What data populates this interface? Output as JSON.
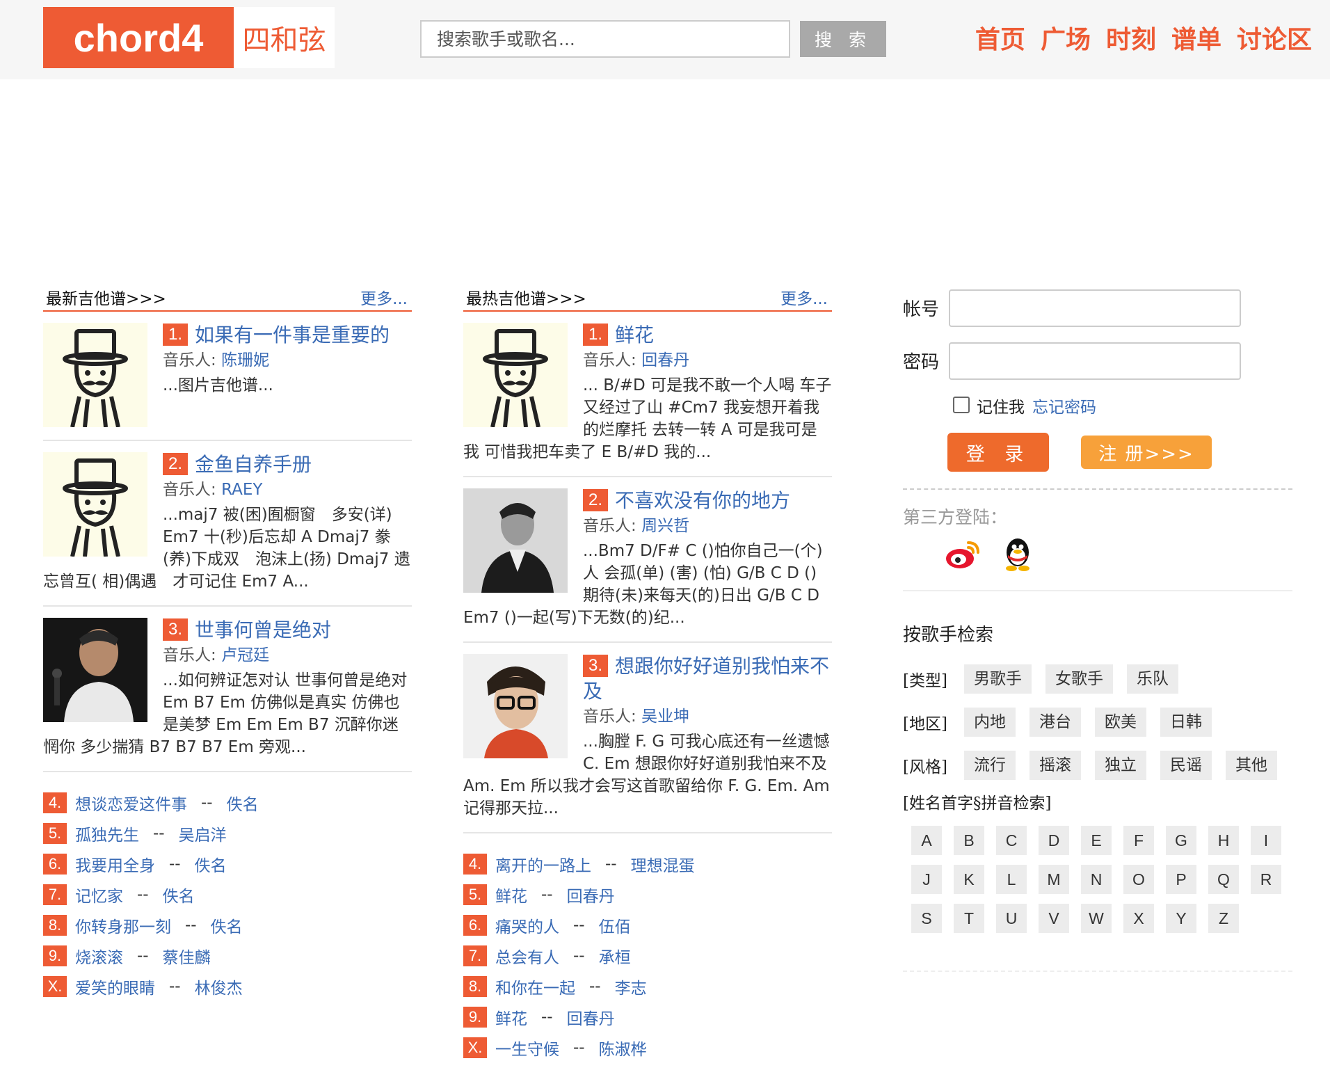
{
  "header": {
    "logo_main": "chord4",
    "logo_cn": "四和弦",
    "search_placeholder": "搜索歌手或歌名...",
    "search_button": "搜 索",
    "nav": [
      "首页",
      "广场",
      "时刻",
      "谱单",
      "讨论区"
    ]
  },
  "latest": {
    "title": "最新吉他谱>>>",
    "more": "更多...",
    "featured": [
      {
        "num": "1.",
        "title": "如果有一件事是重要的",
        "artist_label": "音乐人:",
        "artist": "陈珊妮",
        "snippet": "...图片吉他谱...",
        "thumb": "hat-man"
      },
      {
        "num": "2.",
        "title": "金鱼自养手册",
        "artist_label": "音乐人:",
        "artist": "RAEY",
        "snippet": "...maj7 被(困)囿橱窗　多安(详) Em7 十(秒)后忘却 A Dmaj7 豢(养)下成双　泡沫上(扬) Dmaj7 遗忘曾互( 相)偶遇　才可记住 Em7 A...",
        "thumb": "hat-man"
      },
      {
        "num": "3.",
        "title": "世事何曾是绝对",
        "artist_label": "音乐人:",
        "artist": "卢冠廷",
        "snippet": "...如何辨证怎对认 世事何曾是绝对 Em B7 Em 仿佛似是真实 仿佛也是美梦 Em Em Em B7 沉醉你迷惘你 多少揣猜 B7 B7 B7 Em 旁观...",
        "thumb": "photo-singer"
      }
    ],
    "list": [
      {
        "num": "4.",
        "song": "想谈恋爱这件事",
        "artist": "佚名"
      },
      {
        "num": "5.",
        "song": "孤独先生",
        "artist": "吴启洋"
      },
      {
        "num": "6.",
        "song": "我要用全身",
        "artist": "佚名"
      },
      {
        "num": "7.",
        "song": "记忆家",
        "artist": "佚名"
      },
      {
        "num": "8.",
        "song": "你转身那一刻",
        "artist": "佚名"
      },
      {
        "num": "9.",
        "song": "烧滚滚",
        "artist": "蔡佳麟"
      },
      {
        "num": "X.",
        "song": "爱笑的眼睛",
        "artist": "林俊杰"
      }
    ],
    "sep": "--"
  },
  "hottest": {
    "title": "最热吉他谱>>>",
    "more": "更多...",
    "featured": [
      {
        "num": "1.",
        "title": "鲜花",
        "artist_label": "音乐人:",
        "artist": "回春丹",
        "snippet": "... B/#D 可是我不敢一个人喝 车子又经过了山 #Cm7 我妄想开着我的烂摩托 去转一转 A 可是我可是我 可惜我把车卖了 E B/#D 我的...",
        "thumb": "hat-man"
      },
      {
        "num": "2.",
        "title": "不喜欢没有你的地方",
        "artist_label": "音乐人:",
        "artist": "周兴哲",
        "snippet": "...Bm7 D/F# C ()怕你自己一(个)人 会孤(单) (害) (怕) G/B C D () 期待(未)来每天(的)日出 G/B C D Em7 ()一起(写)下无数(的)纪...",
        "thumb": "photo-bw"
      },
      {
        "num": "3.",
        "title": "想跟你好好道别我怕来不及",
        "artist_label": "音乐人:",
        "artist": "吴业坤",
        "snippet": "...胸膛 F. G 可我心底还有一丝遗憾 C. Em 想跟你好好道别我怕来不及 Am. Em 所以我才会写这首歌留给你 F. G. Em. Am 记得那天拉...",
        "thumb": "photo-glasses"
      }
    ],
    "list": [
      {
        "num": "4.",
        "song": "离开的一路上",
        "artist": "理想混蛋"
      },
      {
        "num": "5.",
        "song": "鲜花",
        "artist": "回春丹"
      },
      {
        "num": "6.",
        "song": "痛哭的人",
        "artist": "伍佰"
      },
      {
        "num": "7.",
        "song": "总会有人",
        "artist": "承桓"
      },
      {
        "num": "8.",
        "song": "和你在一起",
        "artist": "李志"
      },
      {
        "num": "9.",
        "song": "鲜花",
        "artist": "回春丹"
      },
      {
        "num": "X.",
        "song": "一生守候",
        "artist": "陈淑桦"
      }
    ],
    "sep": "--"
  },
  "login": {
    "account_label": "帐号",
    "password_label": "密码",
    "remember": "记住我",
    "forgot": "忘记密码",
    "login_button": "登 录",
    "register_button": "注 册>>>",
    "third_party": "第三方登陆："
  },
  "artist_search": {
    "title": "按歌手检索",
    "rows": [
      {
        "label": "[类型]",
        "tags": [
          "男歌手",
          "女歌手",
          "乐队"
        ]
      },
      {
        "label": "[地区]",
        "tags": [
          "内地",
          "港台",
          "欧美",
          "日韩"
        ]
      },
      {
        "label": "[风格]",
        "tags": [
          "流行",
          "摇滚",
          "独立",
          "民谣",
          "其他"
        ]
      }
    ],
    "pinyin_title": "[姓名首字§拼音检索]",
    "letters": [
      "A",
      "B",
      "C",
      "D",
      "E",
      "F",
      "G",
      "H",
      "I",
      "J",
      "K",
      "L",
      "M",
      "N",
      "O",
      "P",
      "Q",
      "R",
      "S",
      "T",
      "U",
      "V",
      "W",
      "X",
      "Y",
      "Z"
    ]
  },
  "colors": {
    "brand": "#ee5b34",
    "link": "#3a6bb5",
    "login": "#ee6a2c",
    "register": "#f7a13a"
  }
}
